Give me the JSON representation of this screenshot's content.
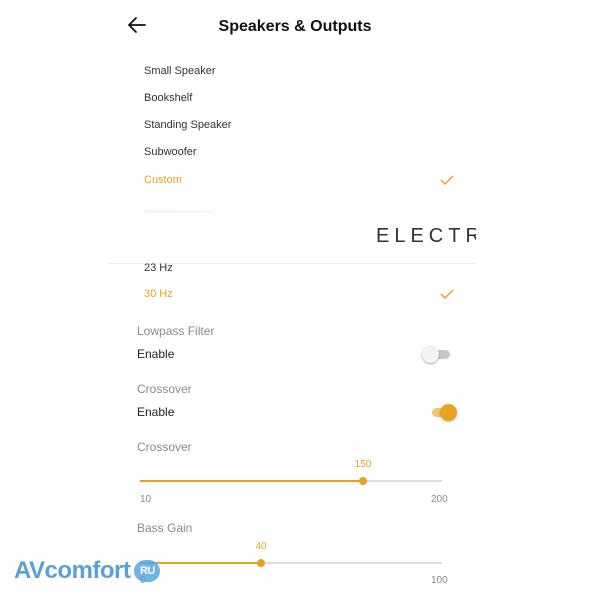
{
  "header": {
    "title": "Speakers & Outputs",
    "back_icon": "arrow-left-icon"
  },
  "speaker_types": [
    {
      "label": "Small Speaker",
      "selected": false
    },
    {
      "label": "Bookshelf",
      "selected": false
    },
    {
      "label": "Standing Speaker",
      "selected": false
    },
    {
      "label": "Subwoofer",
      "selected": false
    },
    {
      "label": "Custom",
      "selected": true
    }
  ],
  "brand": "ELECTRO",
  "frequencies": [
    {
      "label": "23 Hz",
      "selected": false
    },
    {
      "label": "30 Hz",
      "selected": true
    }
  ],
  "lowpass": {
    "heading": "Lowpass Filter",
    "toggle_label": "Enable",
    "enabled": false
  },
  "crossover_toggle": {
    "heading": "Crossover",
    "toggle_label": "Enable",
    "enabled": true
  },
  "crossover_slider": {
    "heading": "Crossover",
    "value": "150",
    "min": "10",
    "max": "200",
    "fraction": 0.74
  },
  "bass_gain": {
    "heading": "Bass Gain",
    "value": "40",
    "min": "0",
    "max": "100",
    "fraction": 0.4
  },
  "watermark": {
    "text": "AVcomfort",
    "suffix": "RU"
  },
  "colors": {
    "accent": "#e8a21f",
    "text": "#222222",
    "muted": "#8a8a8a"
  }
}
